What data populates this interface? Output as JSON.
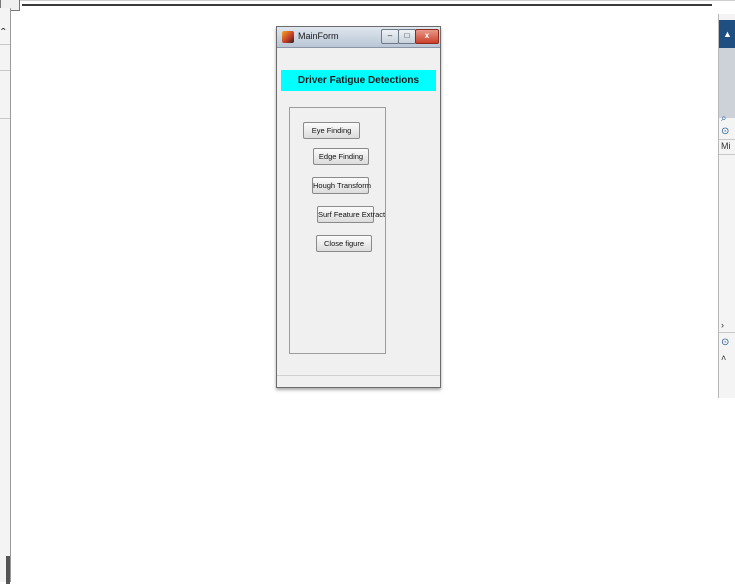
{
  "window": {
    "title": "MainForm",
    "minimize_label": "–",
    "maximize_label": "□",
    "close_label": "x"
  },
  "banner": {
    "text": "Driver Fatigue Detections"
  },
  "buttons": [
    {
      "label": "Eye Finding"
    },
    {
      "label": "Edge Finding"
    },
    {
      "label": "Hough Transform"
    },
    {
      "label": "Surf Feature Extract"
    },
    {
      "label": "Close figure"
    }
  ],
  "background_app": {
    "right_panel_text": "Mi"
  },
  "colors": {
    "banner": "#00ffff",
    "window_bg": "#f0f0f0",
    "close_button": "#c9402b",
    "side_header": "#1f4f80"
  }
}
